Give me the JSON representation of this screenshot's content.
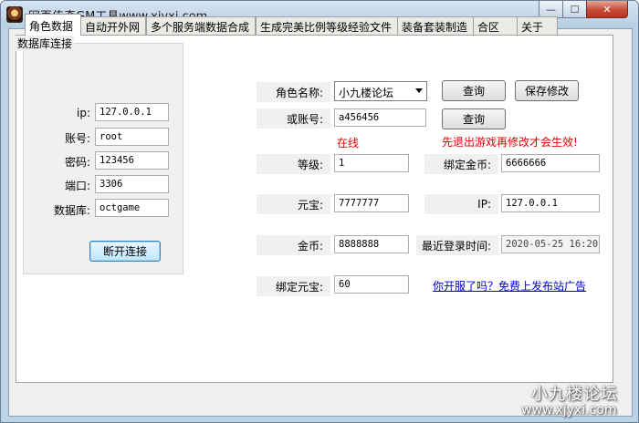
{
  "window": {
    "title": "网页传奇GM工具www.xjyxi.com",
    "controls": {
      "minimize": "—",
      "maximize": "☐",
      "close": "✕"
    }
  },
  "tabs": [
    {
      "label": "角色数据",
      "active": true
    },
    {
      "label": "自动开外网",
      "active": false
    },
    {
      "label": "多个服务端数据合成",
      "active": false
    },
    {
      "label": "生成完美比例等级经验文件",
      "active": false
    },
    {
      "label": "装备套装制造",
      "active": false
    },
    {
      "label": "合区",
      "active": false
    },
    {
      "label": "关于",
      "active": false
    }
  ],
  "db": {
    "group_title": "数据库连接",
    "ip_label": "ip:",
    "ip_value": "127.0.0.1",
    "account_label": "账号:",
    "account_value": "root",
    "password_label": "密码:",
    "password_value": "123456",
    "port_label": "端口:",
    "port_value": "3306",
    "database_label": "数据库:",
    "database_value": "octgame",
    "disconnect_button": "断开连接"
  },
  "role": {
    "name_label": "角色名称:",
    "name_value": "小九楼论坛",
    "query_button": "查询",
    "save_button": "保存修改",
    "account_label": "或账号:",
    "account_value": "a456456",
    "query_button_2": "查询",
    "online_status": "在线",
    "warning": "先退出游戏再修改才会生效!",
    "level_label": "等级:",
    "level_value": "1",
    "bound_gold_label": "绑定金币:",
    "bound_gold_value": "6666666",
    "yuanbao_label": "元宝:",
    "yuanbao_value": "7777777",
    "ip_label": "IP:",
    "ip_value": "127.0.0.1",
    "gold_label": "金币:",
    "gold_value": "8888888",
    "last_login_label": "最近登录时间:",
    "last_login_value": "2020-05-25 16:20:",
    "bound_yuanbao_label": "绑定元宝:",
    "bound_yuanbao_value": "60",
    "ad_link": "你开服了吗？免费上发布站广告"
  },
  "watermark": {
    "line1": "小九楼论坛",
    "line2": "www.xjyxi.com"
  },
  "colors": {
    "warning": "#e00000",
    "link": "#0000cc",
    "titlebar": "#c8daec"
  }
}
